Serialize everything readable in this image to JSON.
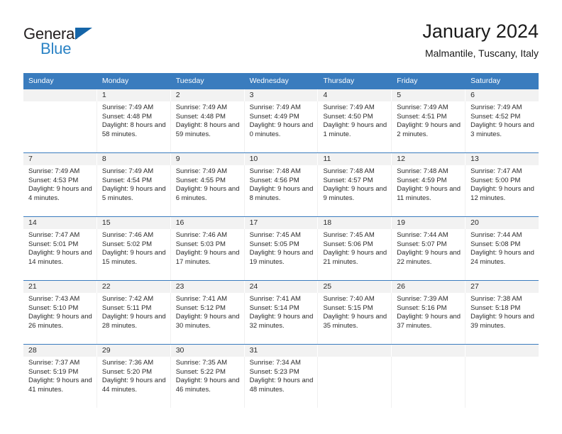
{
  "logo": {
    "word1": "General",
    "word2": "Blue",
    "triangle_color": "#1565a8",
    "word2_color": "#2b83c5"
  },
  "header": {
    "title": "January 2024",
    "subtitle": "Malmantile, Tuscany, Italy"
  },
  "theme": {
    "header_bar": "#3a7cbe",
    "number_row_bg": "#f2f2f2",
    "text": "#2b2b2b"
  },
  "weekdays": [
    "Sunday",
    "Monday",
    "Tuesday",
    "Wednesday",
    "Thursday",
    "Friday",
    "Saturday"
  ],
  "weeks": [
    [
      {
        "day": "",
        "sunrise": "",
        "sunset": "",
        "daylight": ""
      },
      {
        "day": "1",
        "sunrise": "Sunrise: 7:49 AM",
        "sunset": "Sunset: 4:48 PM",
        "daylight": "Daylight: 8 hours and 58 minutes."
      },
      {
        "day": "2",
        "sunrise": "Sunrise: 7:49 AM",
        "sunset": "Sunset: 4:48 PM",
        "daylight": "Daylight: 8 hours and 59 minutes."
      },
      {
        "day": "3",
        "sunrise": "Sunrise: 7:49 AM",
        "sunset": "Sunset: 4:49 PM",
        "daylight": "Daylight: 9 hours and 0 minutes."
      },
      {
        "day": "4",
        "sunrise": "Sunrise: 7:49 AM",
        "sunset": "Sunset: 4:50 PM",
        "daylight": "Daylight: 9 hours and 1 minute."
      },
      {
        "day": "5",
        "sunrise": "Sunrise: 7:49 AM",
        "sunset": "Sunset: 4:51 PM",
        "daylight": "Daylight: 9 hours and 2 minutes."
      },
      {
        "day": "6",
        "sunrise": "Sunrise: 7:49 AM",
        "sunset": "Sunset: 4:52 PM",
        "daylight": "Daylight: 9 hours and 3 minutes."
      }
    ],
    [
      {
        "day": "7",
        "sunrise": "Sunrise: 7:49 AM",
        "sunset": "Sunset: 4:53 PM",
        "daylight": "Daylight: 9 hours and 4 minutes."
      },
      {
        "day": "8",
        "sunrise": "Sunrise: 7:49 AM",
        "sunset": "Sunset: 4:54 PM",
        "daylight": "Daylight: 9 hours and 5 minutes."
      },
      {
        "day": "9",
        "sunrise": "Sunrise: 7:49 AM",
        "sunset": "Sunset: 4:55 PM",
        "daylight": "Daylight: 9 hours and 6 minutes."
      },
      {
        "day": "10",
        "sunrise": "Sunrise: 7:48 AM",
        "sunset": "Sunset: 4:56 PM",
        "daylight": "Daylight: 9 hours and 8 minutes."
      },
      {
        "day": "11",
        "sunrise": "Sunrise: 7:48 AM",
        "sunset": "Sunset: 4:57 PM",
        "daylight": "Daylight: 9 hours and 9 minutes."
      },
      {
        "day": "12",
        "sunrise": "Sunrise: 7:48 AM",
        "sunset": "Sunset: 4:59 PM",
        "daylight": "Daylight: 9 hours and 11 minutes."
      },
      {
        "day": "13",
        "sunrise": "Sunrise: 7:47 AM",
        "sunset": "Sunset: 5:00 PM",
        "daylight": "Daylight: 9 hours and 12 minutes."
      }
    ],
    [
      {
        "day": "14",
        "sunrise": "Sunrise: 7:47 AM",
        "sunset": "Sunset: 5:01 PM",
        "daylight": "Daylight: 9 hours and 14 minutes."
      },
      {
        "day": "15",
        "sunrise": "Sunrise: 7:46 AM",
        "sunset": "Sunset: 5:02 PM",
        "daylight": "Daylight: 9 hours and 15 minutes."
      },
      {
        "day": "16",
        "sunrise": "Sunrise: 7:46 AM",
        "sunset": "Sunset: 5:03 PM",
        "daylight": "Daylight: 9 hours and 17 minutes."
      },
      {
        "day": "17",
        "sunrise": "Sunrise: 7:45 AM",
        "sunset": "Sunset: 5:05 PM",
        "daylight": "Daylight: 9 hours and 19 minutes."
      },
      {
        "day": "18",
        "sunrise": "Sunrise: 7:45 AM",
        "sunset": "Sunset: 5:06 PM",
        "daylight": "Daylight: 9 hours and 21 minutes."
      },
      {
        "day": "19",
        "sunrise": "Sunrise: 7:44 AM",
        "sunset": "Sunset: 5:07 PM",
        "daylight": "Daylight: 9 hours and 22 minutes."
      },
      {
        "day": "20",
        "sunrise": "Sunrise: 7:44 AM",
        "sunset": "Sunset: 5:08 PM",
        "daylight": "Daylight: 9 hours and 24 minutes."
      }
    ],
    [
      {
        "day": "21",
        "sunrise": "Sunrise: 7:43 AM",
        "sunset": "Sunset: 5:10 PM",
        "daylight": "Daylight: 9 hours and 26 minutes."
      },
      {
        "day": "22",
        "sunrise": "Sunrise: 7:42 AM",
        "sunset": "Sunset: 5:11 PM",
        "daylight": "Daylight: 9 hours and 28 minutes."
      },
      {
        "day": "23",
        "sunrise": "Sunrise: 7:41 AM",
        "sunset": "Sunset: 5:12 PM",
        "daylight": "Daylight: 9 hours and 30 minutes."
      },
      {
        "day": "24",
        "sunrise": "Sunrise: 7:41 AM",
        "sunset": "Sunset: 5:14 PM",
        "daylight": "Daylight: 9 hours and 32 minutes."
      },
      {
        "day": "25",
        "sunrise": "Sunrise: 7:40 AM",
        "sunset": "Sunset: 5:15 PM",
        "daylight": "Daylight: 9 hours and 35 minutes."
      },
      {
        "day": "26",
        "sunrise": "Sunrise: 7:39 AM",
        "sunset": "Sunset: 5:16 PM",
        "daylight": "Daylight: 9 hours and 37 minutes."
      },
      {
        "day": "27",
        "sunrise": "Sunrise: 7:38 AM",
        "sunset": "Sunset: 5:18 PM",
        "daylight": "Daylight: 9 hours and 39 minutes."
      }
    ],
    [
      {
        "day": "28",
        "sunrise": "Sunrise: 7:37 AM",
        "sunset": "Sunset: 5:19 PM",
        "daylight": "Daylight: 9 hours and 41 minutes."
      },
      {
        "day": "29",
        "sunrise": "Sunrise: 7:36 AM",
        "sunset": "Sunset: 5:20 PM",
        "daylight": "Daylight: 9 hours and 44 minutes."
      },
      {
        "day": "30",
        "sunrise": "Sunrise: 7:35 AM",
        "sunset": "Sunset: 5:22 PM",
        "daylight": "Daylight: 9 hours and 46 minutes."
      },
      {
        "day": "31",
        "sunrise": "Sunrise: 7:34 AM",
        "sunset": "Sunset: 5:23 PM",
        "daylight": "Daylight: 9 hours and 48 minutes."
      },
      {
        "day": "",
        "sunrise": "",
        "sunset": "",
        "daylight": ""
      },
      {
        "day": "",
        "sunrise": "",
        "sunset": "",
        "daylight": ""
      },
      {
        "day": "",
        "sunrise": "",
        "sunset": "",
        "daylight": ""
      }
    ]
  ]
}
